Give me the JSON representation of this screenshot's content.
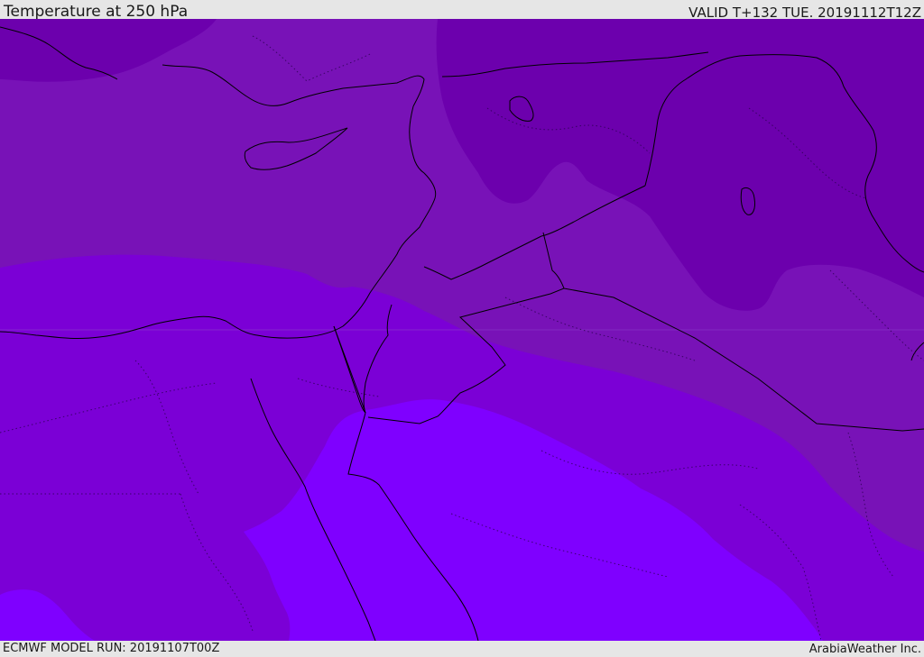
{
  "header": {
    "title": "Temperature at 250 hPa",
    "valid": "VALID T+132 TUE. 20191112T12Z"
  },
  "footer": {
    "model_run": "ECMWF MODEL RUN: 20191107T00Z",
    "credit": "ArabiaWeather Inc."
  },
  "colors": {
    "band_darkest": "#62009d",
    "band_dark": "#6c00ad",
    "band_mid": "#7812b7",
    "band_light": "#7b00d6",
    "band_lightest": "#7f00ff",
    "border_line": "#000000",
    "bar_background": "#e6e6e6"
  }
}
